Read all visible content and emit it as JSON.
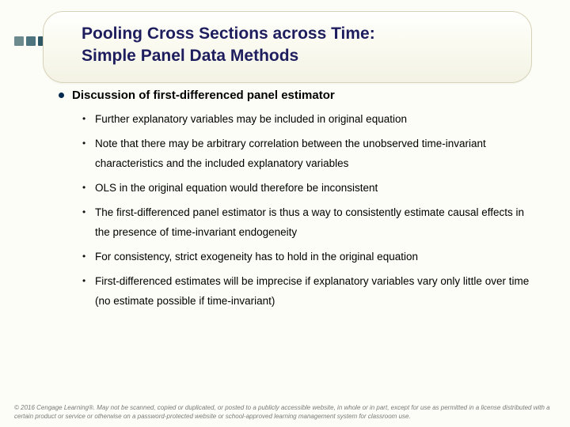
{
  "title": {
    "line1": "Pooling Cross Sections across Time:",
    "line2": "Simple Panel Data Methods"
  },
  "lead": "Discussion of first-differenced panel estimator",
  "bullets": [
    "Further explanatory variables may be included in original equation",
    "Note that there may be arbitrary correlation between the unobserved time-invariant characteristics and the included explanatory variables",
    "OLS in the original equation would therefore be inconsistent",
    "The first-differenced panel estimator is thus a way to consistently estimate causal effects in the presence of time-invariant endogeneity",
    "For consistency, strict exogeneity has to hold in the original equation",
    "First-differenced estimates will be imprecise if explanatory variables vary only little over time (no estimate possible if time-invariant)"
  ],
  "footer": "© 2016 Cengage Learning®. May not be scanned, copied or duplicated, or posted to a publicly accessible website, in whole or in part, except for use as permitted in a license distributed with a certain product or service or otherwise on a password-protected website or school-approved learning management system for classroom use."
}
